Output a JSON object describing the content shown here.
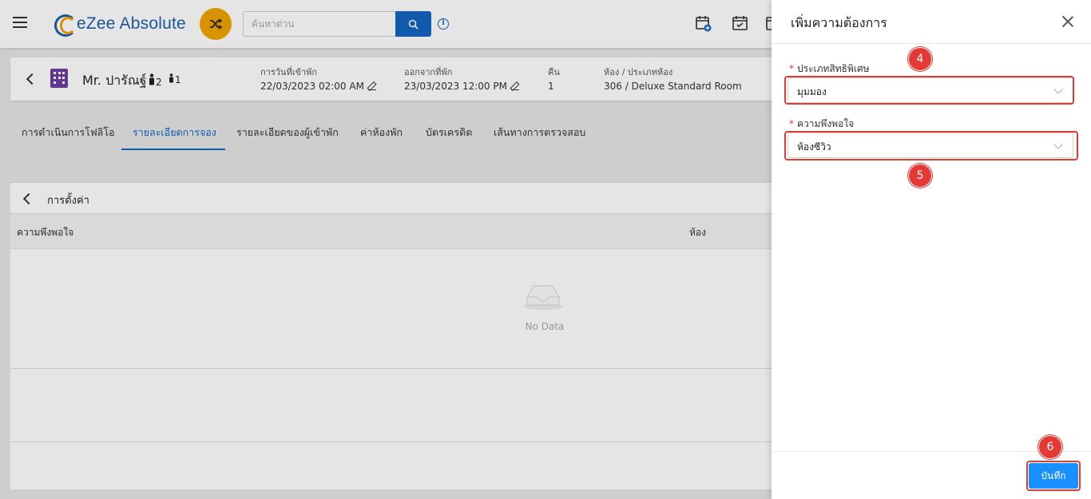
{
  "app": {
    "name": "eZee Absolute"
  },
  "header": {
    "search_placeholder": "ค้นหาด่วน"
  },
  "guest": {
    "name": "Mr. ปารัณฐ์",
    "adults": "2",
    "children": "1",
    "arrival_label": "การวันที่เข้าพัก",
    "arrival_value": "22/03/2023 02:00 AM",
    "departure_label": "ออกจากที่พัก",
    "departure_value": "23/03/2023 12:00 PM",
    "nights_label": "คืน",
    "nights_value": "1",
    "room_label": "ห้อง / ประเภทห้อง",
    "room_value": "306 / Deluxe Standard Room"
  },
  "tabs": [
    {
      "label": "การดำเนินการโฟลิโอ"
    },
    {
      "label": "รายละเอียดการจอง",
      "active": true
    },
    {
      "label": "รายละเอียดของผู้เข้าพัก"
    },
    {
      "label": "ค่าห้องพัก"
    },
    {
      "label": "บัตรเครดิต"
    },
    {
      "label": "เส้นทางการตรวจสอบ"
    }
  ],
  "panel": {
    "title": "การตั้งค่า",
    "columns": [
      "ความพึงพอใจ",
      "ห้อง"
    ],
    "empty_text": "No Data"
  },
  "drawer": {
    "title": "เพิ่มความต้องการ",
    "field1_label": "ประเภทสิทธิพิเศษ",
    "field1_value": "มุมมอง",
    "field2_label": "ความพึงพอใจ",
    "field2_value": "ห้องซีวิว",
    "save_label": "บันทึก",
    "required_mark": "*"
  },
  "annotations": {
    "badge4": "4",
    "badge5": "5",
    "badge6": "6"
  },
  "colors": {
    "primary": "#1565c0",
    "accent": "#f0a500",
    "highlight": "#e53935",
    "save_button": "#1890ff"
  }
}
